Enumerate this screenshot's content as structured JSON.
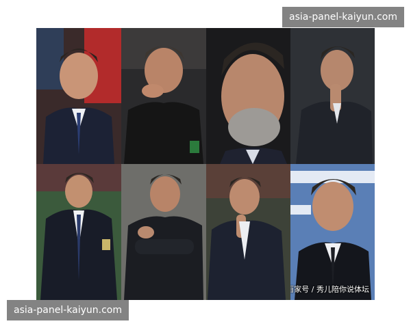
{
  "watermarks": {
    "top": "asia-panel-kaiyun.com",
    "bottom": "asia-panel-kaiyun.com"
  },
  "image_credit": "百家号 / 秀儿陪你说体坛",
  "collage": {
    "rows": 2,
    "columns": 4,
    "tiles": [
      {
        "background": "stadium-red",
        "pose": "standing-looking-ahead"
      },
      {
        "background": "dark-stands",
        "pose": "hand-at-mouth"
      },
      {
        "background": "dark",
        "pose": "close-up-grey-beard"
      },
      {
        "background": "dark",
        "pose": "hand-on-chin"
      },
      {
        "background": "stadium-green",
        "pose": "standing-suit"
      },
      {
        "background": "stadium-grey",
        "pose": "arms-crossed"
      },
      {
        "background": "stadium-blurry",
        "pose": "hand-on-chin-smile"
      },
      {
        "background": "press-board-blue",
        "pose": "portrait-white-shirt"
      }
    ]
  },
  "colors": {
    "watermark_bg": "#787878",
    "watermark_text": "#ffffff",
    "page_bg": "#ffffff"
  }
}
